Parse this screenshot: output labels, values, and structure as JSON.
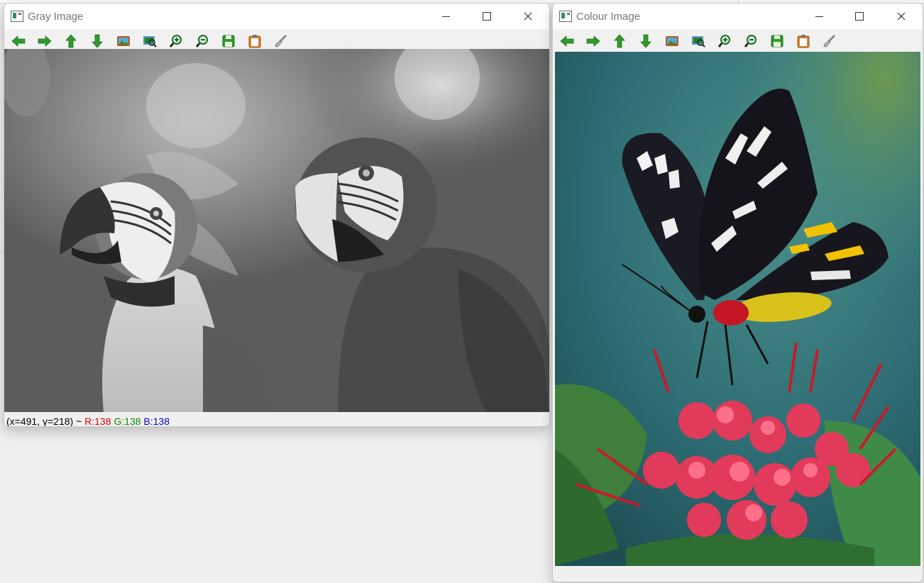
{
  "windows": [
    {
      "id": "gray",
      "title": "Gray Image",
      "status": {
        "coords": "(x=491, y=218) ~",
        "r": "R:138",
        "g": "G:138",
        "b": "B:138"
      }
    },
    {
      "id": "colour",
      "title": "Colour Image",
      "status": {}
    }
  ],
  "toolbar_icons": [
    "arrow-left-icon",
    "arrow-right-icon",
    "arrow-up-icon",
    "arrow-down-icon",
    "image-icon",
    "zoom-fit-icon",
    "zoom-in-icon",
    "zoom-out-icon",
    "save-icon",
    "clipboard-icon",
    "brush-icon"
  ],
  "colors": {
    "toolbar_green": "#2f9a2a",
    "status_red": "#dd0000",
    "status_green": "#0a8a00",
    "status_blue": "#0000cc"
  }
}
